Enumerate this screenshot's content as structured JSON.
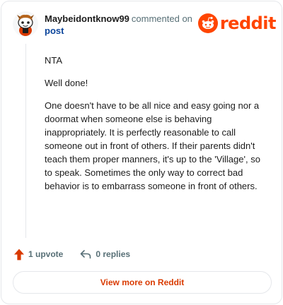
{
  "comment": {
    "username": "Maybeidontknow99",
    "action_text": "commented on",
    "target_link": "post",
    "paragraphs": [
      "NTA",
      "Well done!",
      "One doesn't have to be all nice and easy going nor a doormat when someone else is behaving inappropriately. It is perfectly reasonable to call someone out in front of others. If their parents didn't teach them proper manners, it's up to the 'Village', so to speak. Sometimes the only way to correct bad behavior is to embarrass someone in front of others."
    ],
    "upvotes_label": "1 upvote",
    "replies_label": "0 replies"
  },
  "brand": {
    "wordmark": "reddit",
    "color": "#ff4500"
  },
  "footer": {
    "view_more_label": "View more on Reddit"
  },
  "icons": {
    "avatar": "snoo-avatar-icon",
    "logo": "reddit-logo-icon",
    "upvote": "upvote-arrow-icon",
    "reply": "reply-arrow-icon"
  }
}
